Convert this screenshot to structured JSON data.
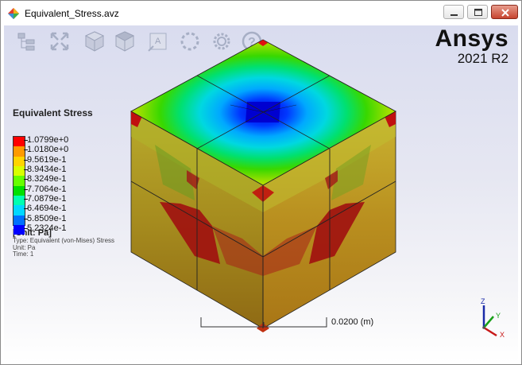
{
  "window": {
    "title": "Equivalent_Stress.avz"
  },
  "brand": {
    "name": "Ansys",
    "version": "2021 R2"
  },
  "toolbar": {
    "icons": [
      "tree-icon",
      "fit-view-icon",
      "iso-view-icon",
      "wireframe-icon",
      "annotation-icon",
      "rotate-icon",
      "settings-icon",
      "help-icon"
    ]
  },
  "legend": {
    "title": "Equivalent Stress",
    "values": [
      "1.0799e+0",
      "1.0180e+0",
      "9.5619e-1",
      "8.9434e-1",
      "8.3249e-1",
      "7.7064e-1",
      "7.0879e-1",
      "6.4694e-1",
      "5.8509e-1",
      "5.2324e-1"
    ],
    "colors": [
      "#ff0000",
      "#ff9a00",
      "#ffd400",
      "#d8ff00",
      "#66ff00",
      "#00e000",
      "#00ffb0",
      "#00d8ff",
      "#0070ff",
      "#0000ff"
    ],
    "unit": "[Unit: Pa]",
    "type_line": "Type: Equivalent (von-Mises) Stress",
    "unit_line": "Unit: Pa",
    "time_line": "Time: 1"
  },
  "scale": {
    "label": "0.0200  (m)"
  },
  "triad": {
    "x": "X",
    "y": "Y",
    "z": "Z"
  }
}
